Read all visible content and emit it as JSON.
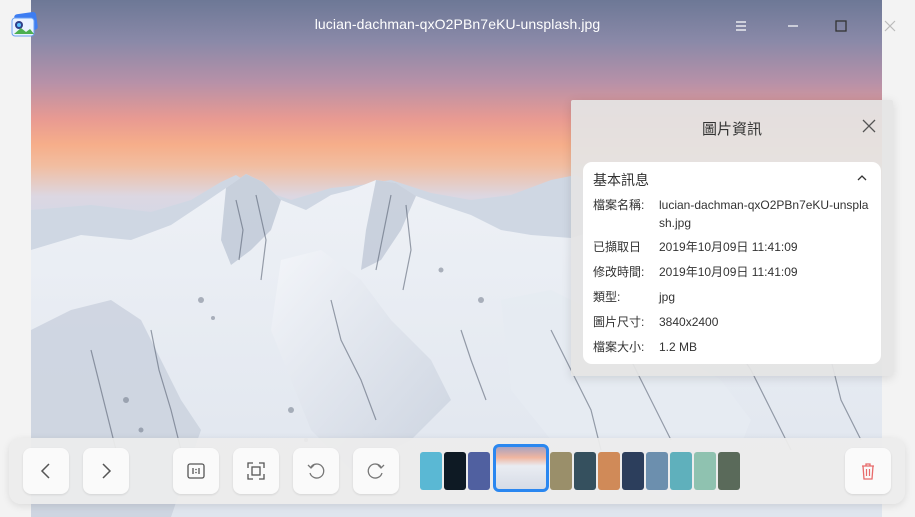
{
  "window": {
    "title": "lucian-dachman-qxO2PBn7eKU-unsplash.jpg",
    "icons": [
      "app-photo-icon",
      "menu-icon",
      "minimize-icon",
      "maximize-icon",
      "close-icon"
    ]
  },
  "info_panel": {
    "title": "圖片資訊",
    "section_title": "基本訊息",
    "rows": [
      {
        "key": "檔案名稱:",
        "value": "lucian-dachman-qxO2PBn7eKU-unsplash.jpg"
      },
      {
        "key": "已擷取日",
        "value": "2019年10月09日 11:41:09"
      },
      {
        "key": "修改時間:",
        "value": "2019年10月09日 11:41:09"
      },
      {
        "key": "類型:",
        "value": "jpg"
      },
      {
        "key": "圖片尺寸:",
        "value": "3840x2400"
      },
      {
        "key": "檔案大小:",
        "value": "1.2 MB"
      }
    ]
  },
  "toolbar": {
    "buttons": [
      "previous-icon",
      "next-icon",
      "original-size-icon",
      "fit-window-icon",
      "rotate-left-icon",
      "rotate-right-icon",
      "delete-icon"
    ],
    "thumbnail_colors": [
      "#5ab8d4",
      "#0e1a24",
      "#5060a0",
      "#e0d7e0",
      "#9a8f6a",
      "#35505e",
      "#d08a58",
      "#2c3e5c",
      "#6c8fae",
      "#5fb0bc",
      "#8fc2b0",
      "#5a6a5a"
    ],
    "selected_thumbnail": 3
  },
  "colors": {
    "accent": "#2a87f0",
    "delete": "#e86a6a"
  }
}
